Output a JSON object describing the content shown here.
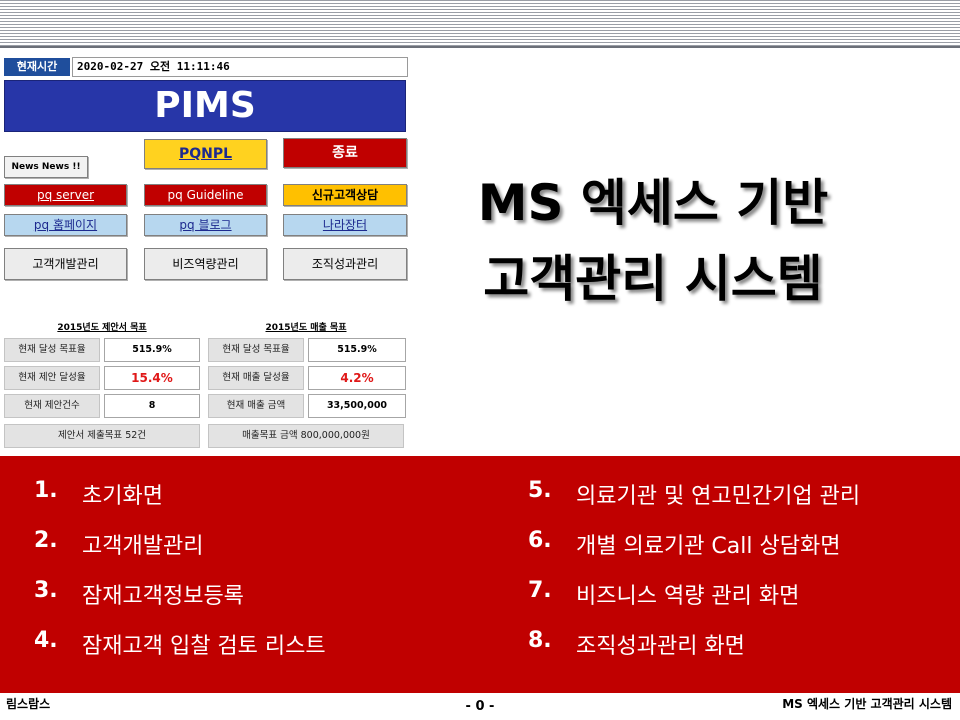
{
  "form": {
    "time_label": "현재시간",
    "time_value": "2020-02-27 오전 11:11:46",
    "banner": "PIMS",
    "buttons": {
      "news": "News News !!",
      "pqnpl": "PQNPL",
      "exit": "종료",
      "pq_server": "pq server",
      "pq_guideline": "pq Guideline",
      "new_customer": "신규고객상담",
      "pq_homepage": "pq 홈페이지",
      "pq_blog": "pq 블로그",
      "nara_market": "나라장터",
      "customer_dev": "고객개발관리",
      "biz_capability": "비즈역량관리",
      "org_performance": "조직성과관리"
    },
    "left_panel": {
      "title": "2015년도 제안서 목표",
      "rows": [
        {
          "label": "현재 달성 목표율",
          "value": "515.9%"
        },
        {
          "label": "현재 제안 달성율",
          "value": "15.4%"
        },
        {
          "label": "현재 제안건수",
          "value": "8"
        }
      ],
      "footer": "제안서 제출목표 52건"
    },
    "right_panel": {
      "title": "2015년도 매출 목표",
      "rows": [
        {
          "label": "현재 달성 목표율",
          "value": "515.9%"
        },
        {
          "label": "현재 매출 달성율",
          "value": "4.2%"
        },
        {
          "label": "현재 매출 금액",
          "value": "33,500,000"
        }
      ],
      "footer": "매출목표 금액 800,000,000원"
    }
  },
  "headline": {
    "line1": "MS 엑세스 기반",
    "line2": "고객관리 시스템"
  },
  "agenda": [
    {
      "num": "1.",
      "text": "초기화면"
    },
    {
      "num": "2.",
      "text": "고객개발관리"
    },
    {
      "num": "3.",
      "text": "잠재고객정보등록"
    },
    {
      "num": "4.",
      "text": "잠재고객 입찰 검토 리스트"
    },
    {
      "num": "5.",
      "text": "의료기관 및 연고민간기업 관리"
    },
    {
      "num": "6.",
      "text": "개별 의료기관 Call 상담화면"
    },
    {
      "num": "7.",
      "text": "비즈니스 역량 관리 화면"
    },
    {
      "num": "8.",
      "text": "조직성과관리 화면"
    }
  ],
  "footer": {
    "left": "림스람스",
    "center": "- 0 -",
    "right": "MS 엑세스 기반 고객관리 시스템"
  },
  "colors": {
    "agenda_red": "#c00000",
    "banner_blue": "#2736a8",
    "pqnpl_yellow": "#ffd21f",
    "highlight_red_text": "#e01818"
  }
}
